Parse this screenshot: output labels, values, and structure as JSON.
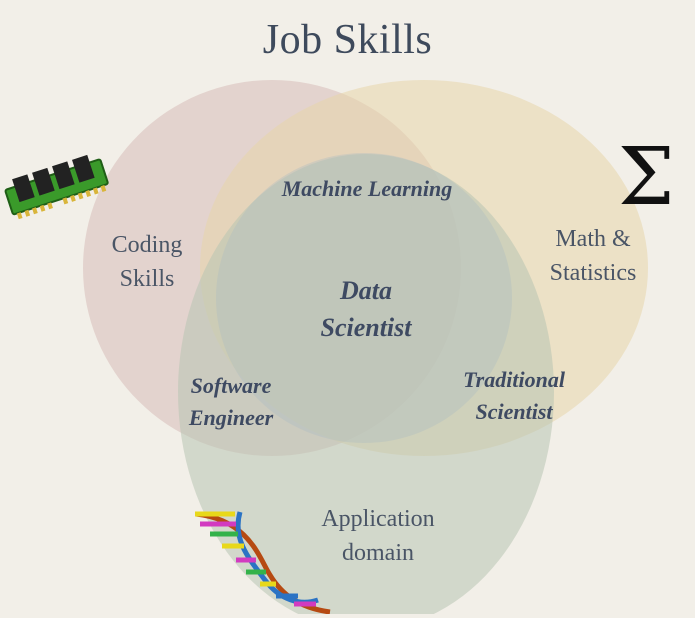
{
  "title": "Job Skills",
  "regions": {
    "coding": "Coding\nSkills",
    "math": "Math &\nStatistics",
    "application": "Application\ndomain",
    "machine_learning": "Machine Learning",
    "data_scientist": "Data\nScientist",
    "software_engineer": "Software\nEngineer",
    "traditional_scientist": "Traditional\nScientist"
  },
  "icons": {
    "math": "sigma-icon",
    "coding": "memory-chip-icon",
    "application": "dna-icon"
  },
  "sigma_glyph": "Σ",
  "colors": {
    "background": "#f2efe8",
    "coding_circle": "#d7bcb8",
    "math_circle": "#e7d6a9",
    "application_circle": "#b8c4b2"
  }
}
